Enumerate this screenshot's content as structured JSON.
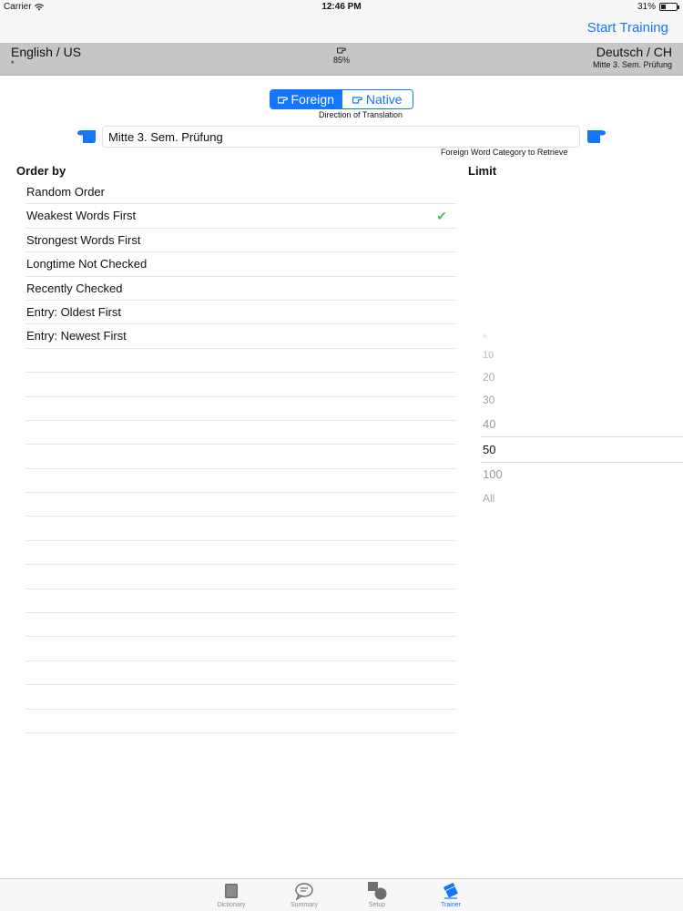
{
  "status": {
    "carrier": "Carrier",
    "time": "12:46 PM",
    "battery_text": "31%",
    "battery_level": 0.31
  },
  "nav": {
    "start_training": "Start Training"
  },
  "langbar": {
    "left_language": "English / US",
    "left_sub": "*",
    "center_percent": "85%",
    "right_language": "Deutsch / CH",
    "right_sub": "Mitte 3. Sem. Prüfung"
  },
  "direction": {
    "options": [
      "Foreign",
      "Native"
    ],
    "selected": "Foreign",
    "label": "Direction of Translation"
  },
  "category": {
    "value": "Mitte 3. Sem. Prüfung",
    "label": "Foreign Word Category to Retrieve"
  },
  "order": {
    "title": "Order by",
    "items": [
      "Random Order",
      "Weakest Words First",
      "Strongest Words First",
      "Longtime Not Checked",
      "Recently Checked",
      "Entry: Oldest First",
      "Entry: Newest First"
    ],
    "selected": "Weakest Words First"
  },
  "limit": {
    "title": "Limit",
    "options": [
      "5",
      "10",
      "20",
      "30",
      "40",
      "50",
      "100",
      "All"
    ],
    "selected": "50"
  },
  "tabs": {
    "items": [
      "Dictionary",
      "Summary",
      "Setup",
      "Trainer"
    ],
    "active": "Trainer"
  },
  "colors": {
    "accent": "#1476fb",
    "check": "#4cc552",
    "langbar": "#c6c6c6"
  }
}
